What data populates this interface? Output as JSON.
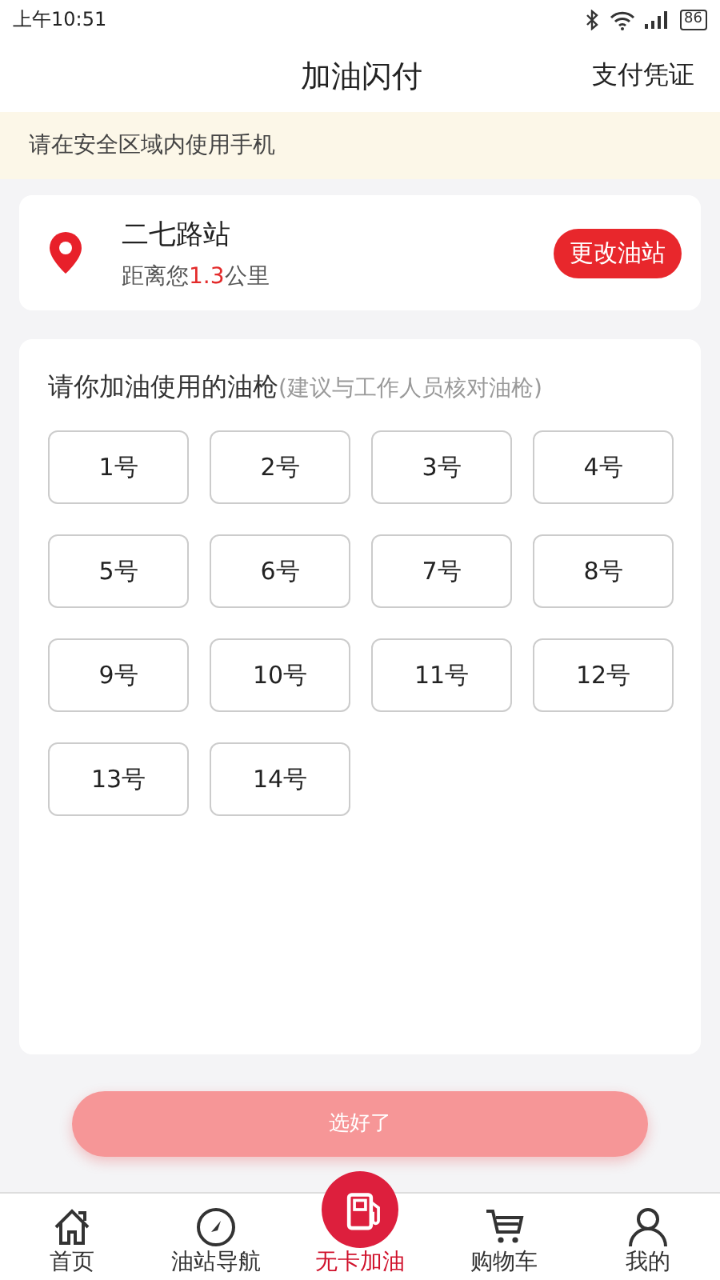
{
  "status_bar": {
    "time": "上午10:51",
    "battery": "86"
  },
  "header": {
    "title": "加油闪付",
    "action": "支付凭证"
  },
  "notice": "请在安全区域内使用手机",
  "station": {
    "name": "二七路站",
    "distance_prefix": "距离您",
    "distance": "1.3",
    "distance_suffix": "公里",
    "change_button": "更改油站"
  },
  "nozzles": {
    "title": "请你加油使用的油枪",
    "hint": "(建议与工作人员核对油枪)",
    "items": [
      {
        "label": "1号",
        "selected": false
      },
      {
        "label": "2号",
        "selected": false
      },
      {
        "label": "3号",
        "selected": false
      },
      {
        "label": "4号",
        "selected": false
      },
      {
        "label": "5号",
        "selected": false
      },
      {
        "label": "6号",
        "selected": false
      },
      {
        "label": "7号",
        "selected": false
      },
      {
        "label": "8号",
        "selected": false
      },
      {
        "label": "9号",
        "selected": false
      },
      {
        "label": "10号",
        "selected": false
      },
      {
        "label": "11号",
        "selected": false
      },
      {
        "label": "12号",
        "selected": false
      },
      {
        "label": "13号",
        "selected": false
      },
      {
        "label": "14号",
        "selected": false
      }
    ]
  },
  "confirm": {
    "label": "选好了",
    "disabled": true
  },
  "tabs": [
    {
      "label": "首页",
      "kind": "home",
      "selected": false
    },
    {
      "label": "油站导航",
      "kind": "compass",
      "selected": false
    },
    {
      "label": "无卡加油",
      "kind": "pump",
      "selected": true
    },
    {
      "label": "购物车",
      "kind": "cart",
      "selected": false
    },
    {
      "label": "我的",
      "kind": "person",
      "selected": false
    }
  ]
}
